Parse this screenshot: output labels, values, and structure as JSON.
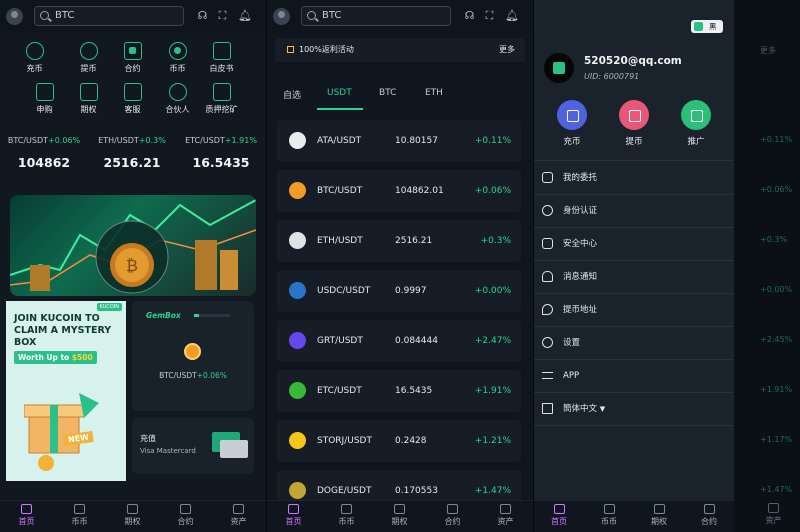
{
  "search": {
    "value": "BTC"
  },
  "home": {
    "nav": [
      {
        "label": "充币",
        "icon": "deposit-icon"
      },
      {
        "label": "提币",
        "icon": "withdraw-icon"
      },
      {
        "label": "合约",
        "icon": "contract-icon"
      },
      {
        "label": "币币",
        "icon": "spot-icon"
      },
      {
        "label": "白皮书",
        "icon": "whitepaper-icon"
      },
      {
        "label": "申购",
        "icon": "subscribe-icon"
      },
      {
        "label": "期权",
        "icon": "options-icon"
      },
      {
        "label": "客服",
        "icon": "support-icon"
      },
      {
        "label": "合伙人",
        "icon": "partner-icon"
      },
      {
        "label": "质押挖矿",
        "icon": "staking-icon"
      }
    ],
    "tickers": [
      {
        "pair": "BTC/USDT",
        "change": "+0.06%",
        "price": "104862"
      },
      {
        "pair": "ETH/USDT",
        "change": "+0.3%",
        "price": "2516.21"
      },
      {
        "pair": "ETC/USDT",
        "change": "+1.91%",
        "price": "16.5435"
      }
    ],
    "promo": {
      "logo": "KUCOIN",
      "title": "JOIN KUCOIN TO CLAIM A MYSTERY BOX",
      "badge_prefix": "Worth Up to ",
      "badge_amount": "$500",
      "box_label": "NEW"
    },
    "gembox": {
      "title": "GemBox",
      "pair": "BTC/USDT",
      "change": "+0.06%"
    },
    "charge": {
      "title": "充值",
      "subtitle": "Visa Mastercard"
    }
  },
  "bottom_nav": [
    {
      "label": "首页",
      "active": true
    },
    {
      "label": "币币",
      "active": false
    },
    {
      "label": "期权",
      "active": false
    },
    {
      "label": "合约",
      "active": false
    },
    {
      "label": "资产",
      "active": false
    }
  ],
  "market": {
    "notice": "100%返利活动",
    "notice_more": "更多",
    "tabs": [
      "自选",
      "USDT",
      "BTC",
      "ETH"
    ],
    "active_tab": "USDT",
    "rows": [
      {
        "pair": "ATA/USDT",
        "price": "10.80157",
        "change": "+0.11%",
        "color": "#e8ecf0"
      },
      {
        "pair": "BTC/USDT",
        "price": "104862.01",
        "change": "+0.06%",
        "color": "#f29b29"
      },
      {
        "pair": "ETH/USDT",
        "price": "2516.21",
        "change": "+0.3%",
        "color": "#dfe3e8"
      },
      {
        "pair": "USDC/USDT",
        "price": "0.9997",
        "change": "+0.00%",
        "color": "#2775ca"
      },
      {
        "pair": "GRT/USDT",
        "price": "0.084444",
        "change": "+2.47%",
        "color": "#6747ed"
      },
      {
        "pair": "ETC/USDT",
        "price": "16.5435",
        "change": "+1.91%",
        "color": "#3ab83a"
      },
      {
        "pair": "STORJ/USDT",
        "price": "0.2428",
        "change": "+1.21%",
        "color": "#f5c518"
      },
      {
        "pair": "DOGE/USDT",
        "price": "0.170553",
        "change": "+1.47%",
        "color": "#c2a633"
      }
    ]
  },
  "drawer": {
    "theme_label": "黑",
    "email": "520520@qq.com",
    "uid": "UID: 6000791",
    "quick_actions": [
      {
        "label": "充币",
        "color": "#4f63e0",
        "icon": "deposit-icon"
      },
      {
        "label": "提币",
        "color": "#e8577a",
        "icon": "withdraw-icon"
      },
      {
        "label": "推广",
        "color": "#2bbf7a",
        "icon": "share-icon"
      }
    ],
    "menu": [
      {
        "label": "我的委托",
        "icon": "user-add-icon"
      },
      {
        "label": "身份认证",
        "icon": "id-badge-icon"
      },
      {
        "label": "安全中心",
        "icon": "lock-icon"
      },
      {
        "label": "消息通知",
        "icon": "bell-icon"
      },
      {
        "label": "提币地址",
        "icon": "location-icon"
      },
      {
        "label": "设置",
        "icon": "gear-icon"
      },
      {
        "label": "APP",
        "icon": "swap-icon"
      },
      {
        "label": "簡体中文",
        "icon": "language-icon"
      }
    ],
    "background_more": "更多",
    "background_changes": [
      "+0.11%",
      "+0.06%",
      "+0.3%",
      "+0.00%",
      "+2.45%",
      "+1.91%",
      "+1.17%",
      "+1.47%"
    ]
  }
}
